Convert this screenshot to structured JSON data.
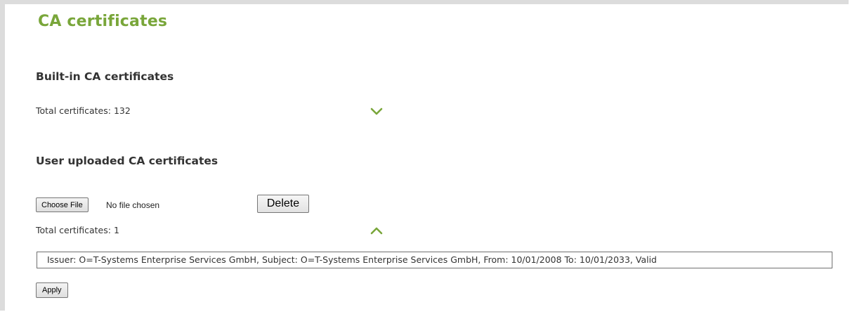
{
  "page": {
    "title": "CA certificates"
  },
  "builtin": {
    "heading": "Built-in CA certificates",
    "total_label": "Total certificates: 132",
    "toggle_icon": "chevron-down-icon"
  },
  "user": {
    "heading": "User uploaded CA certificates",
    "choose_file_label": "Choose File",
    "file_status": "No file chosen",
    "delete_label": "Delete",
    "total_label": "Total certificates: 1",
    "toggle_icon": "chevron-up-icon",
    "certificates": [
      "Issuer: O=T-Systems Enterprise Services GmbH, Subject: O=T-Systems Enterprise Services GmbH, From: 10/01/2008 To: 10/01/2033, Valid"
    ],
    "apply_label": "Apply"
  },
  "colors": {
    "accent": "#79a63a",
    "text": "#333333",
    "frame": "#dcdcdc"
  }
}
